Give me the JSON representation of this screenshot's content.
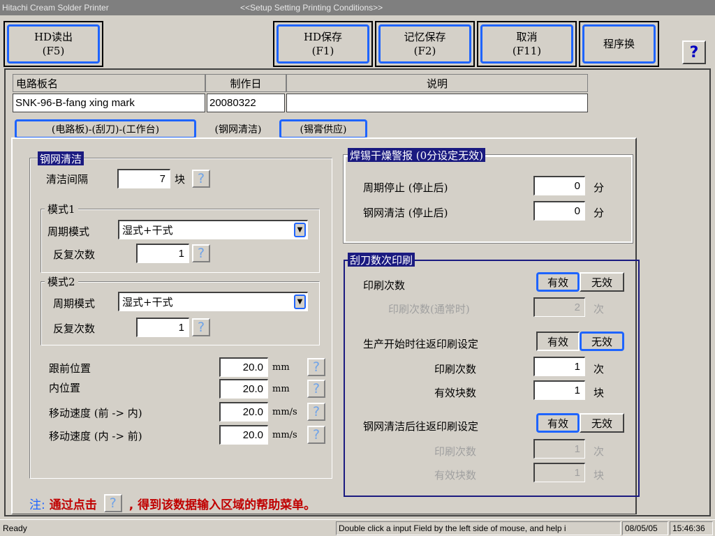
{
  "window": {
    "app_title": "Hitachi Cream Solder Printer",
    "screen_title": "<<Setup Setting Printing Conditions>>"
  },
  "toolbar": {
    "hd_load": {
      "line1": "HD读出",
      "line2": "(F5)"
    },
    "hd_save": {
      "line1": "HD保存",
      "line2": "(F1)"
    },
    "mem_save": {
      "line1": "记忆保存",
      "line2": "(F2)"
    },
    "cancel": {
      "line1": "取消",
      "line2": "(F11)"
    },
    "program_switch": {
      "line1": "程序换"
    },
    "help": "?"
  },
  "header": {
    "board_name_label": "电路板名",
    "date_label": "制作日",
    "desc_label": "说明",
    "board_name": "SNK-96-B-fang xing mark",
    "date": "20080322",
    "desc": ""
  },
  "tabs": [
    {
      "label": "(电路板)-(刮刀)-(工作台)"
    },
    {
      "label": "(钢网清洁)"
    },
    {
      "label": "(锡膏供应)"
    }
  ],
  "stencil_clean": {
    "title": "钢网清洁",
    "interval_label": "清洁间隔",
    "interval_value": "7",
    "interval_unit": "块",
    "mode1": {
      "title": "模式1",
      "cycle_label": "周期模式",
      "cycle_value": "湿式+干式",
      "repeat_label": "反复次数",
      "repeat_value": "1"
    },
    "mode2": {
      "title": "模式2",
      "cycle_label": "周期模式",
      "cycle_value": "湿式+干式",
      "repeat_label": "反复次数",
      "repeat_value": "1"
    },
    "positions": [
      {
        "label": "跟前位置",
        "value": "20.0",
        "unit": "mm"
      },
      {
        "label": "内位置",
        "value": "20.0",
        "unit": "mm"
      },
      {
        "label": "移动速度 (前 -> 内)",
        "value": "20.0",
        "unit": "mm/s"
      },
      {
        "label": "移动速度 (内 -> 前)",
        "value": "20.0",
        "unit": "mm/s"
      }
    ]
  },
  "dry_alarm": {
    "title": "焊锡干燥警报 (0分设定无效)",
    "rows": [
      {
        "label": "周期停止 (停止后)",
        "value": "0",
        "unit": "分"
      },
      {
        "label": "钢网清洁 (停止后)",
        "value": "0",
        "unit": "分"
      }
    ]
  },
  "squeegee": {
    "title": "刮刀数次印刷",
    "print_count_label": "印刷次数",
    "valid": "有效",
    "invalid": "无效",
    "normal_count_label": "印刷次数(通常时)",
    "normal_count_value": "2",
    "normal_count_unit": "次",
    "prod_start_label": "生产开始时往返印刷设定",
    "prod_print_label": "印刷次数",
    "prod_print_value": "1",
    "prod_print_unit": "次",
    "prod_blocks_label": "有效块数",
    "prod_blocks_value": "1",
    "prod_blocks_unit": "块",
    "after_clean_label": "钢网清洁后往返印刷设定",
    "ac_print_label": "印刷次数",
    "ac_print_value": "1",
    "ac_print_unit": "次",
    "ac_blocks_label": "有效块数",
    "ac_blocks_value": "1",
    "ac_blocks_unit": "块"
  },
  "note": {
    "prefix": "注:",
    "text1": "通过点击",
    "text2": ", 得到该数据输入区域的帮助菜单。"
  },
  "status": {
    "ready": "Ready",
    "hint": "Double click a input Field by the left side of mouse, and help i",
    "date": "08/05/05",
    "time": "15:46:36"
  },
  "colors": {
    "window_bg": "#d4d0c8",
    "highlight_blue": "#1e64ff",
    "group_title_bg": "#1a1a80",
    "note_red": "#c00000"
  }
}
